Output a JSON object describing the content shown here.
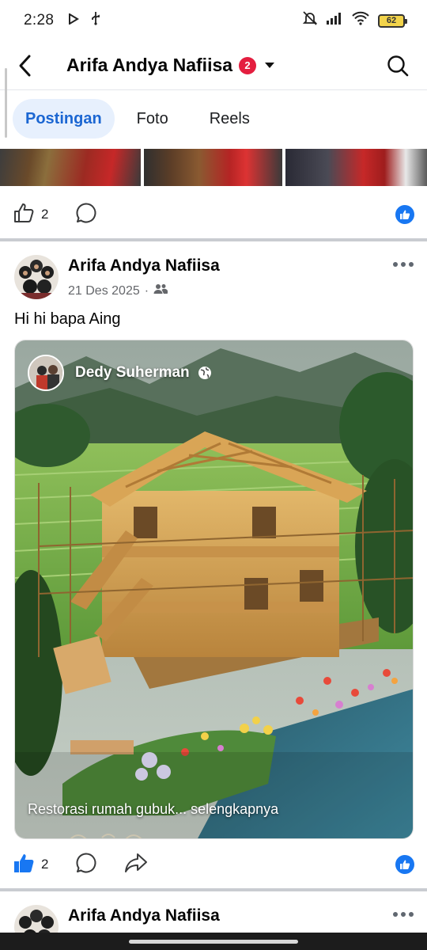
{
  "status": {
    "time": "2:28",
    "battery": "62"
  },
  "header": {
    "title": "Arifa Andya Nafiisa",
    "badge_count": "2"
  },
  "tabs": [
    {
      "label": "Postingan",
      "active": true
    },
    {
      "label": "Foto",
      "active": false
    },
    {
      "label": "Reels",
      "active": false
    }
  ],
  "prev_post": {
    "like_count": "2"
  },
  "post": {
    "author": "Arifa Andya Nafiisa",
    "date": "21 Des 2025",
    "date_separator": "·",
    "text": "Hi hi bapa Aing",
    "shared": {
      "owner": "Dedy Suherman",
      "caption": "Restorasi rumah gubuk... selengkapnya"
    },
    "like_count": "2"
  },
  "next_post": {
    "author": "Arifa Andya Nafiisa"
  },
  "colors": {
    "brand_blue": "#1877f2",
    "active_tab_bg": "#e7f0fd",
    "badge_red": "#e41e3f"
  }
}
